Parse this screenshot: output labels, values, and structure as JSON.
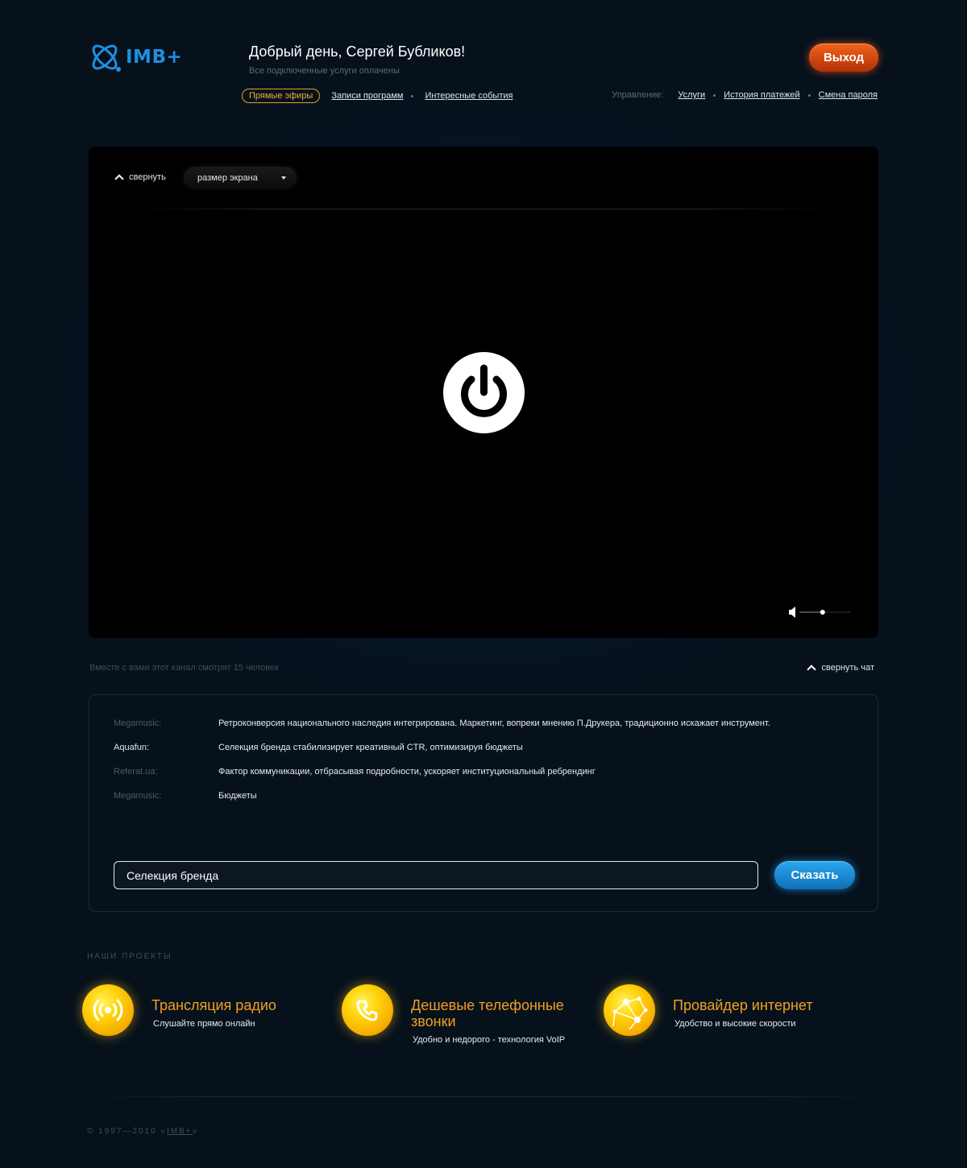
{
  "header": {
    "logo_text": "IMB+",
    "greeting": "Добрый день, Сергей Бубликов!",
    "subgreeting": "Все подключенные услуги оплачены",
    "logout_label": "Выход"
  },
  "nav": {
    "items": [
      {
        "label": "Прямые эфиры",
        "active": true
      },
      {
        "label": "Записи программ",
        "active": false
      },
      {
        "label": "Интересные события",
        "active": false
      }
    ]
  },
  "manage": {
    "label": "Управление:",
    "items": [
      {
        "label": "Услуги"
      },
      {
        "label": "История платежей"
      },
      {
        "label": "Смена пароля"
      }
    ]
  },
  "player": {
    "collapse_label": "свернуть",
    "screen_size_label": "размер экрана",
    "volume_level": 0.45
  },
  "viewers_text": "Вместе с вами этот канал смотрят 15 человек",
  "collapse_chat_label": "свернуть чат",
  "chat": {
    "messages": [
      {
        "author": "Megamusic:",
        "text": "Ретроконверсия национального наследия интегрирована. Маркетинг, вопреки мнению П.Друкера, традиционно искажает инструмент.",
        "active": false
      },
      {
        "author": "Aquafun:",
        "text": "Селекция бренда стабилизирует креативный CTR, оптимизируя бюджеты",
        "active": true
      },
      {
        "author": "Referat.ua:",
        "text": "Фактор коммуникации, отбрасывая подробности, ускоряет институциональный ребрендинг",
        "active": false
      },
      {
        "author": "Megamusic:",
        "text": "Бюджеты",
        "active": false
      }
    ],
    "input_value": "Селекция бренда",
    "send_label": "Сказать"
  },
  "projects": {
    "title": "НАШИ ПРОЕКТЫ",
    "items": [
      {
        "title": "Трансляция радио",
        "desc": "Слушайте прямо онлайн",
        "icon": "radio-icon"
      },
      {
        "title": "Дешевые телефонные звонки",
        "desc": "Удобно и недорого - технология VoIP",
        "icon": "phone-icon"
      },
      {
        "title": "Провайдер интернет",
        "desc": "Удобство и высокие скорости",
        "icon": "network-icon"
      }
    ]
  },
  "footer": {
    "prefix": "© 1997—2010 «",
    "brand": "IMB+",
    "suffix": "»"
  },
  "colors": {
    "accent_orange": "#f0a020",
    "logout": "#e0501a",
    "send": "#1e90e0",
    "logo_blue": "#1f8fe0"
  }
}
